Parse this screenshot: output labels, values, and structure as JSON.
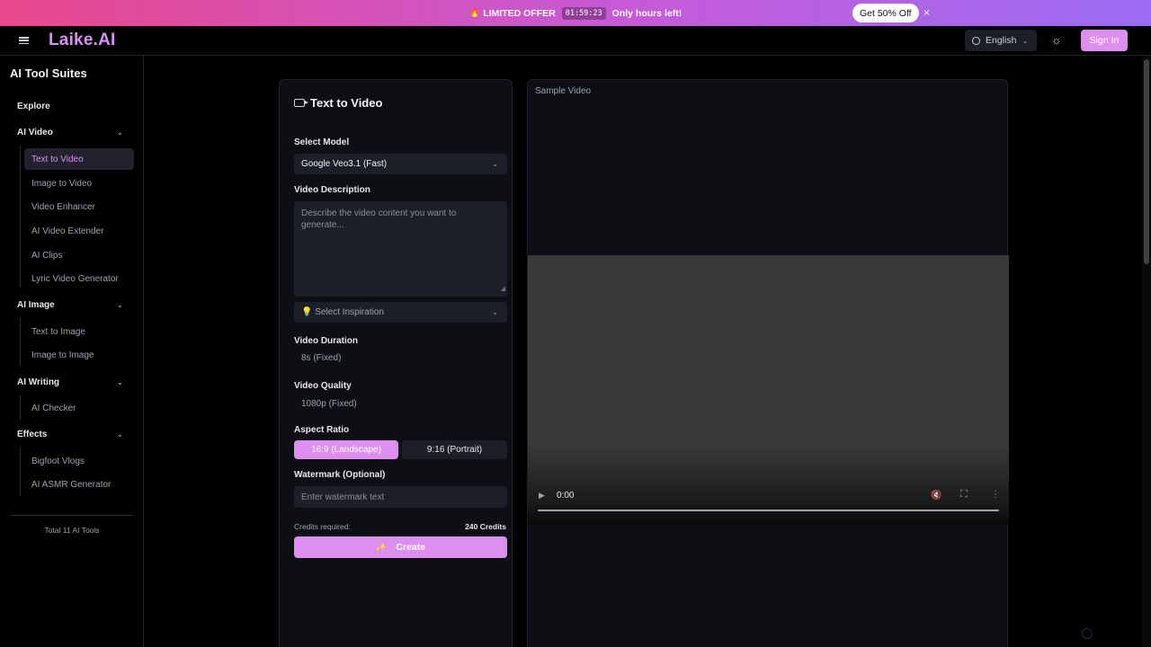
{
  "promo": {
    "fire": "🔥",
    "label": "LIMITED OFFER",
    "timer": "01:59:23",
    "message": "Only hours left!",
    "cta": "Get 50% Off",
    "close": "×"
  },
  "header": {
    "logo": "Laike.AI",
    "language": "English",
    "sign_in": "Sign In"
  },
  "sidebar": {
    "title": "AI Tool Suites",
    "explore": "Explore",
    "sections": [
      {
        "label": "AI Video",
        "items": [
          "Text to Video",
          "Image to Video",
          "Video Enhancer",
          "AI Video Extender",
          "AI Clips",
          "Lyric Video Generator"
        ]
      },
      {
        "label": "AI Image",
        "items": [
          "Text to Image",
          "Image to Image"
        ]
      },
      {
        "label": "AI Writing",
        "items": [
          "AI Checker"
        ]
      },
      {
        "label": "Effects",
        "items": [
          "Bigfoot Vlogs",
          "AI ASMR Generator"
        ]
      }
    ],
    "total": "Total 11 AI Tools"
  },
  "form": {
    "title": "Text to Video",
    "model_label": "Select Model",
    "model_value": "Google Veo3.1 (Fast)",
    "description_label": "Video Description",
    "description_placeholder": "Describe the video content you want to generate...",
    "inspiration": "💡 Select Inspiration",
    "duration_label": "Video Duration",
    "duration_value": "8s (Fixed)",
    "quality_label": "Video Quality",
    "quality_value": "1080p (Fixed)",
    "aspect_label": "Aspect Ratio",
    "aspect_landscape": "16:9 (Landscape)",
    "aspect_portrait": "9:16 (Portrait)",
    "watermark_label": "Watermark (Optional)",
    "watermark_placeholder": "Enter watermark text",
    "credits_label": "Credits required:",
    "credits_value": "240 Credits",
    "create": "Create"
  },
  "sample": {
    "title": "Sample Video",
    "time": "0:00"
  },
  "colors": {
    "accent": "#dd8ff0",
    "background": "#000000",
    "panel": "#0d0f14",
    "field": "#1c1f27"
  }
}
